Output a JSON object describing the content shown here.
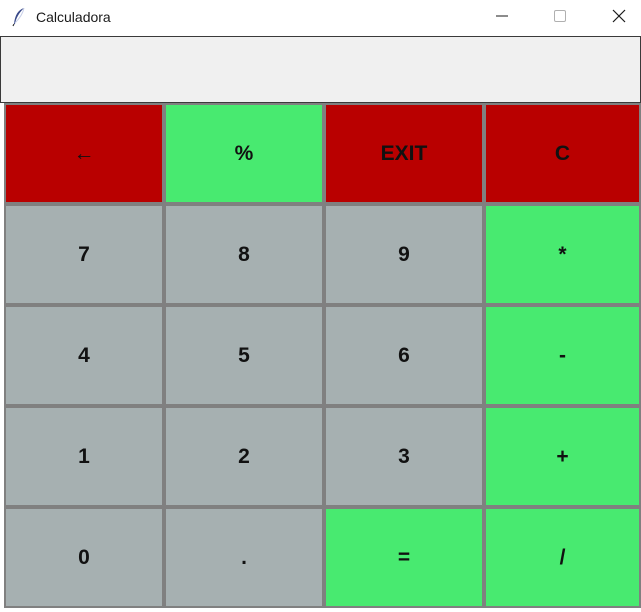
{
  "window": {
    "title": "Calculadora",
    "icon": "feather-icon",
    "controls": [
      "minimize-icon",
      "maximize-icon",
      "close-icon"
    ]
  },
  "display": {
    "value": ""
  },
  "colors": {
    "red": "#b90000",
    "green": "#48ea70",
    "gray": "#a6b0b1",
    "border": "#808080",
    "display_bg": "#f0f0f0"
  },
  "buttons": {
    "backspace": "←",
    "percent": "%",
    "exit": "EXIT",
    "clear": "C",
    "seven": "7",
    "eight": "8",
    "nine": "9",
    "multiply": "*",
    "four": "4",
    "five": "5",
    "six": "6",
    "minus": "-",
    "one": "1",
    "two": "2",
    "three": "3",
    "plus": "+",
    "zero": "0",
    "dot": ".",
    "equals": "=",
    "divide": "/"
  }
}
